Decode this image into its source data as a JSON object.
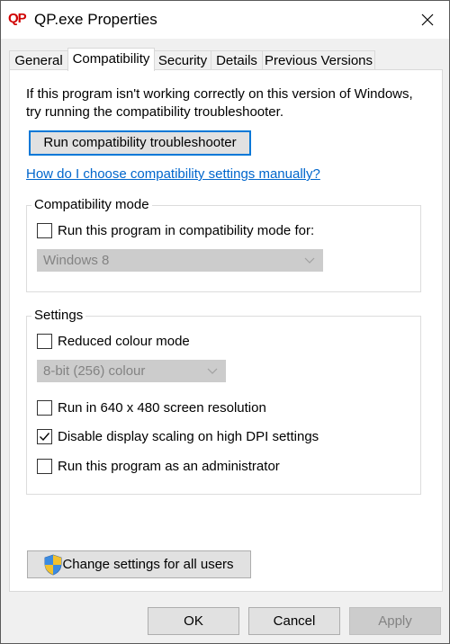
{
  "window": {
    "app_icon": "QP",
    "title": "QP.exe Properties"
  },
  "tabs": [
    {
      "label": "General"
    },
    {
      "label": "Compatibility"
    },
    {
      "label": "Security"
    },
    {
      "label": "Details"
    },
    {
      "label": "Previous Versions"
    }
  ],
  "compat": {
    "intro": "If this program isn't working correctly on this version of Windows, try running the compatibility troubleshooter.",
    "troubleshooter_button": "Run compatibility troubleshooter",
    "manual_link": "How do I choose compatibility settings manually?"
  },
  "compat_mode": {
    "group_label": "Compatibility mode",
    "checkbox_label": "Run this program in compatibility mode for:",
    "checked": false,
    "os_select_value": "Windows 8"
  },
  "settings": {
    "group_label": "Settings",
    "reduced_colour_label": "Reduced colour mode",
    "reduced_colour_checked": false,
    "colour_select_value": "8-bit (256) colour",
    "res_640_label": "Run in 640 x 480 screen resolution",
    "res_640_checked": false,
    "dpi_label": "Disable display scaling on high DPI settings",
    "dpi_checked": true,
    "admin_label": "Run this program as an administrator",
    "admin_checked": false
  },
  "change_all_users_button": "Change settings for all users",
  "footer": {
    "ok": "OK",
    "cancel": "Cancel",
    "apply": "Apply"
  },
  "icons": {
    "close": "close-icon",
    "check": "checkmark-icon",
    "chevron": "chevron-down-icon",
    "shield": "uac-shield-icon"
  }
}
